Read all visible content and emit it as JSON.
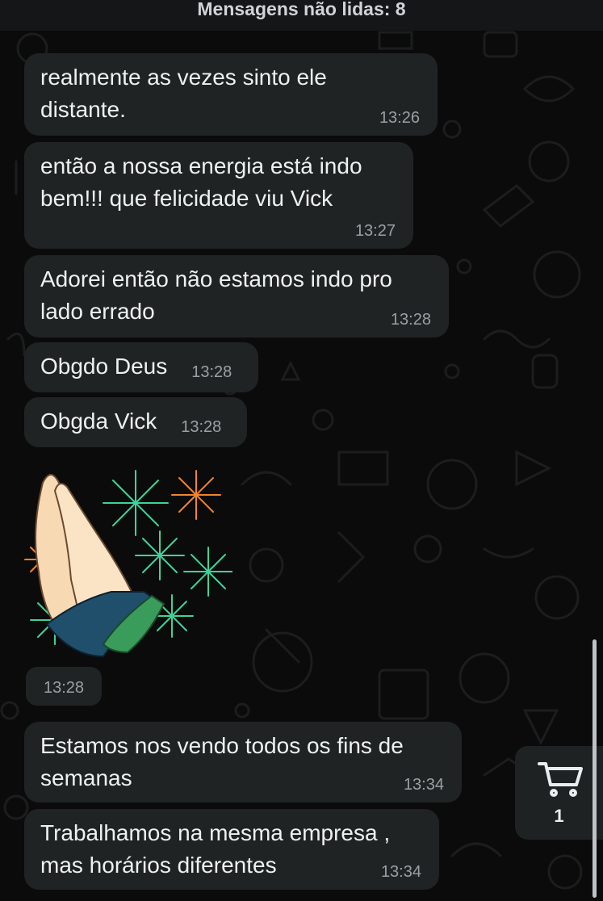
{
  "header": {
    "unread_label": "Mensagens não lidas: 8"
  },
  "messages": [
    {
      "lines": [
        "realmente as vezes sinto ele",
        "distante."
      ],
      "time": "13:26"
    },
    {
      "lines": [
        "então a nossa energia está indo",
        "bem!!! que felicidade viu Vick"
      ],
      "time": "13:27"
    },
    {
      "lines": [
        "Adorei então não estamos indo pro",
        "lado errado"
      ],
      "time": "13:28"
    },
    {
      "text": "Obgdo Deus",
      "time": "13:28"
    },
    {
      "text": "Obgda Vick",
      "time": "13:28"
    },
    {
      "text": "Estamos nos vendo todos os fins de",
      "text2": "semanas",
      "time": "13:34"
    },
    {
      "text": "Trabalhamos na mesma empresa ,",
      "text2": "mas horários diferentes",
      "time": "13:34"
    }
  ],
  "sticker": {
    "icon": "praying-hands-sticker",
    "time": "13:28"
  },
  "cart": {
    "icon": "cart-icon",
    "count": "1"
  },
  "colors": {
    "bubble": "#202324",
    "background": "#0b0b0b",
    "timestamp": "#9aa0a3"
  }
}
